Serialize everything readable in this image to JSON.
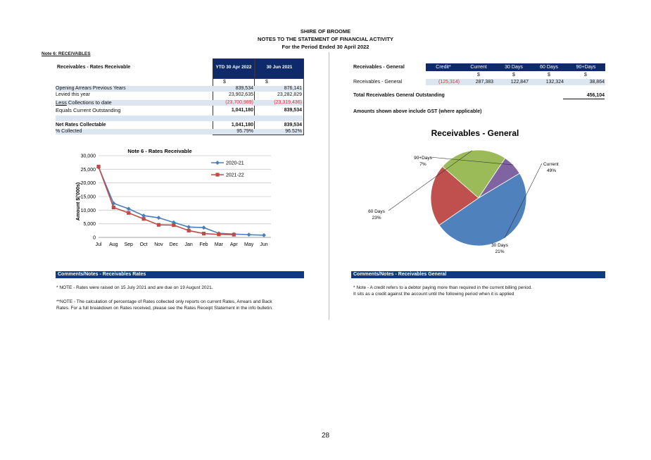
{
  "header": {
    "org": "SHIRE OF BROOME",
    "title": "NOTES TO THE STATEMENT OF FINANCIAL ACTIVITY",
    "period": "For the Period Ended 30 April 2022"
  },
  "note_label": "Note 6: RECEIVABLES",
  "rates": {
    "section_title": "Receivables - Rates Receivable",
    "col1": "YTD 30 Apr 2022",
    "col2": "30 Jun 2021",
    "unit": "$",
    "rows": [
      {
        "label": "Opening Arrears Previous Years",
        "v1": "839,534",
        "v2": "876,141"
      },
      {
        "label": "Levied this year",
        "v1": "23,902,635",
        "v2": "23,282,829"
      },
      {
        "label_prefix": "Less",
        "label": " Collections to date",
        "v1": "(23,700,989)",
        "v2": "(23,319,436)"
      },
      {
        "label": "Equals Current Outstanding",
        "v1": "1,041,180",
        "v2": "839,534"
      }
    ],
    "net_label": "Net Rates Collectable",
    "net_v1": "1,041,180",
    "net_v2": "839,534",
    "pct_label": "% Collected",
    "pct_v1": "95.79%",
    "pct_v2": "96.52%"
  },
  "general": {
    "section_title": "Receivables - General",
    "columns": [
      "Credit*",
      "Current",
      "30 Days",
      "60 Days",
      "90+Days"
    ],
    "unit": "$",
    "row_label": "Receivables - General",
    "values": [
      "(125,314)",
      "287,383",
      "122,847",
      "132,324",
      "38,864"
    ],
    "total_label": "Total Receivables General Outstanding",
    "total_value": "456,104",
    "gst_note": "Amounts shown above include GST (where applicable)"
  },
  "chart_data": [
    {
      "type": "line",
      "title": "Note 6 - Rates Receivable",
      "ylabel": "Amount $('000s)",
      "categories": [
        "Jul",
        "Aug",
        "Sep",
        "Oct",
        "Nov",
        "Dec",
        "Jan",
        "Feb",
        "Mar",
        "Apr",
        "May",
        "Jun"
      ],
      "ylim": [
        0,
        30000
      ],
      "yticks": [
        "0",
        "5,000",
        "10,000",
        "15,000",
        "20,000",
        "25,000",
        "30,000"
      ],
      "grid": true,
      "legend": "top-right",
      "series": [
        {
          "name": "2020-21",
          "color": "#4a7ebb",
          "marker": "diamond",
          "values": [
            25800,
            12500,
            10500,
            8000,
            7200,
            5500,
            3800,
            3600,
            1500,
            1200,
            1000,
            800
          ]
        },
        {
          "name": "2021-22",
          "color": "#be4b48",
          "marker": "square",
          "values": [
            26000,
            11000,
            9000,
            6800,
            4600,
            4500,
            2500,
            1400,
            1100,
            1000
          ]
        }
      ]
    },
    {
      "type": "pie",
      "title": "Receivables - General",
      "slices": [
        {
          "label": "Current",
          "percent": "49%",
          "value": 49,
          "color": "#4f81bd"
        },
        {
          "label": "30 Days",
          "percent": "21%",
          "value": 21,
          "color": "#c0504d"
        },
        {
          "label": "60 Days",
          "percent": "23%",
          "value": 23,
          "color": "#9bbb59"
        },
        {
          "label": "90+Days",
          "percent": "7%",
          "value": 7,
          "color": "#8064a2"
        }
      ]
    }
  ],
  "comments_rates": {
    "title": "Comments/Notes - Receivables Rates",
    "note1": "* NOTE - Rates were raised on 15 July 2021 and are due on 19 August 2021.",
    "note2a": "**NOTE - The calculation of percentage of Rates collected only reports on current Rates, Arrears and Back",
    "note2b": "Rates. For a full breakdown on Rates received, please see the Rates Receipt Statement in the info bulletin."
  },
  "comments_general": {
    "title": "Comments/Notes - Receivables General",
    "note1": "* Note - A credit refers to a debtor paying more than required in the current billing period.",
    "note2": "It sits as a credit against the account until the following period when it is applied"
  },
  "page_number": "28"
}
